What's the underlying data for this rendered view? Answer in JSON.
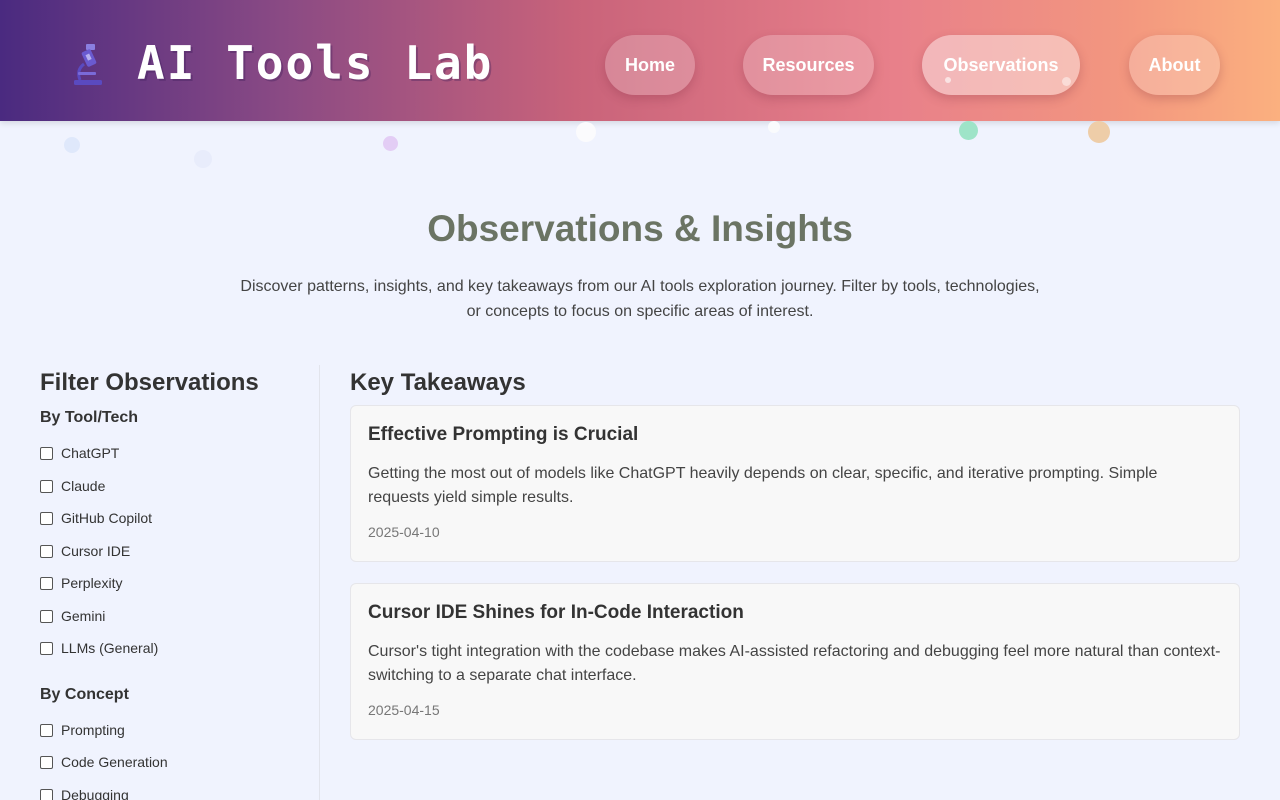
{
  "header": {
    "logo_text": "AI Tools Lab",
    "logo_icon": "microscope-icon",
    "nav": [
      {
        "label": "Home",
        "active": false
      },
      {
        "label": "Resources",
        "active": false
      },
      {
        "label": "Observations",
        "active": true
      },
      {
        "label": "About",
        "active": false
      }
    ]
  },
  "page": {
    "title": "Observations & Insights",
    "intro": "Discover patterns, insights, and key takeaways from our AI tools exploration journey. Filter by tools, technologies, or concepts to focus on specific areas of interest."
  },
  "sidebar": {
    "title": "Filter Observations",
    "tool_heading": "By Tool/Tech",
    "tools": [
      "ChatGPT",
      "Claude",
      "GitHub Copilot",
      "Cursor IDE",
      "Perplexity",
      "Gemini",
      "LLMs (General)"
    ],
    "concept_heading": "By Concept",
    "concepts": [
      "Prompting",
      "Code Generation",
      "Debugging"
    ]
  },
  "main": {
    "title": "Key Takeaways",
    "cards": [
      {
        "title": "Effective Prompting is Crucial",
        "body": "Getting the most out of models like ChatGPT heavily depends on clear, specific, and iterative prompting. Simple requests yield simple results.",
        "date": "2025-04-10"
      },
      {
        "title": "Cursor IDE Shines for In-Code Interaction",
        "body": "Cursor's tight integration with the codebase makes AI-assisted refactoring and debugging feel more natural than context-switching to a separate chat interface.",
        "date": "2025-04-15"
      }
    ]
  },
  "colors": {
    "page_bg": "#f0f3fe",
    "title": "#6b7464",
    "header_gradient_start": "#4a2a80",
    "header_gradient_end": "#fbb07f"
  }
}
